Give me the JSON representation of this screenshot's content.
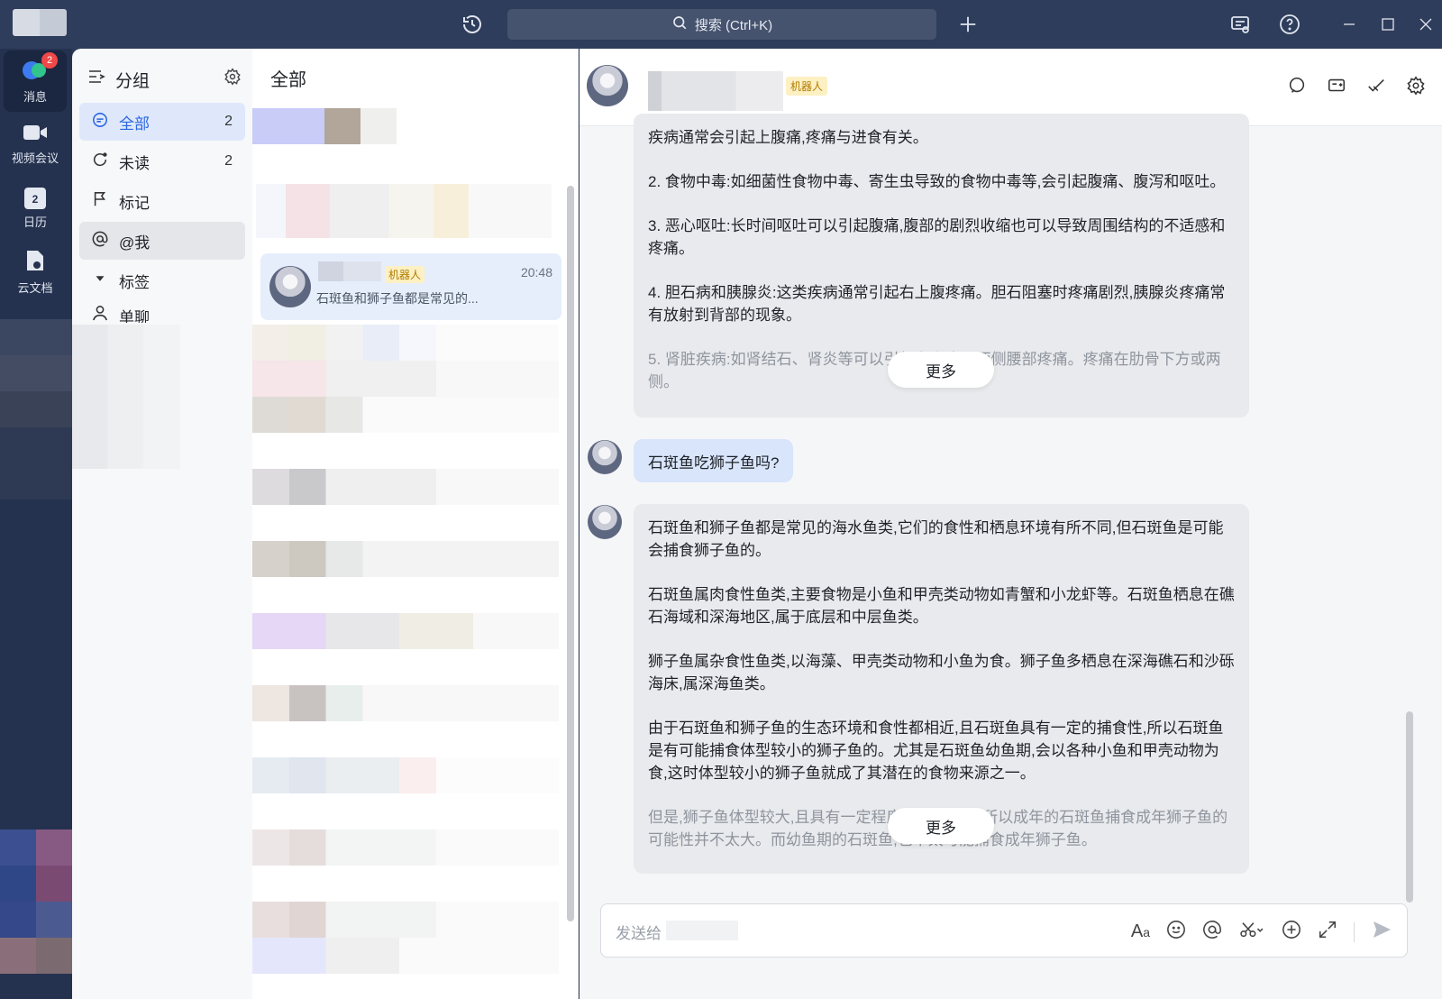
{
  "titlebar": {
    "search_label": "搜索 (Ctrl+K)"
  },
  "rail": {
    "badge": "2",
    "items": [
      {
        "label": "消息",
        "icon": "chat-bubble-icon"
      },
      {
        "label": "视频会议",
        "icon": "video-camera-icon"
      },
      {
        "label": "日历",
        "icon": "calendar-icon"
      },
      {
        "label": "云文档",
        "icon": "cloud-doc-icon"
      }
    ],
    "calendar_day": "2"
  },
  "groups": {
    "title": "分组",
    "items": [
      {
        "label": "全部",
        "count": "2"
      },
      {
        "label": "未读",
        "count": "2"
      },
      {
        "label": "标记",
        "count": ""
      },
      {
        "label": "@我",
        "count": ""
      },
      {
        "label": "标签",
        "count": ""
      },
      {
        "label": "单聊",
        "count": ""
      }
    ]
  },
  "convlist": {
    "title": "全部",
    "active": {
      "badge": "机器人",
      "time": "20:48",
      "preview": "石斑鱼和狮子鱼都是常见的..."
    }
  },
  "chat": {
    "header_badge": "机器人",
    "msg1": {
      "lines": [
        "疾病通常会引起上腹痛,疼痛与进食有关。",
        "2. 食物中毒:如细菌性食物中毒、寄生虫导致的食物中毒等,会引起腹痛、腹泻和呕吐。",
        "3. 恶心呕吐:长时间呕吐可以引起腹痛,腹部的剧烈收缩也可以导致周围结构的不适感和疼痛。",
        "4. 胆石病和胰腺炎:这类疾病通常引起右上腹疼痛。胆石阻塞时疼痛剧烈,胰腺炎疼痛常有放射到背部的现象。",
        "5. 肾脏疾病:如肾结石、肾炎等可以引起右上腹及两侧腰部疼痛。疼痛在肋骨下方或两侧。"
      ],
      "more": "更多"
    },
    "user_msg": "石斑鱼吃狮子鱼吗?",
    "msg2": {
      "lines": [
        "石斑鱼和狮子鱼都是常见的海水鱼类,它们的食性和栖息环境有所不同,但石斑鱼是可能会捕食狮子鱼的。",
        "石斑鱼属肉食性鱼类,主要食物是小鱼和甲壳类动物如青蟹和小龙虾等。石斑鱼栖息在礁石海域和深海地区,属于底层和中层鱼类。",
        "狮子鱼属杂食性鱼类,以海藻、甲壳类动物和小鱼为食。狮子鱼多栖息在深海礁石和沙砾海床,属深海鱼类。",
        "由于石斑鱼和狮子鱼的生态环境和食性都相近,且石斑鱼具有一定的捕食性,所以石斑鱼是有可能捕食体型较小的狮子鱼的。尤其是石斑鱼幼鱼期,会以各种小鱼和甲壳动物为食,这时体型较小的狮子鱼就成了其潜在的食物来源之一。",
        "但是,狮子鱼体型较大,且具有一定程度的自卫能力,所以成年的石斑鱼捕食成年狮子鱼的可能性并不太大。而幼鱼期的石斑鱼,也不太可能捕食成年狮子鱼。"
      ],
      "more": "更多"
    },
    "composer_placeholder": "发送给"
  }
}
